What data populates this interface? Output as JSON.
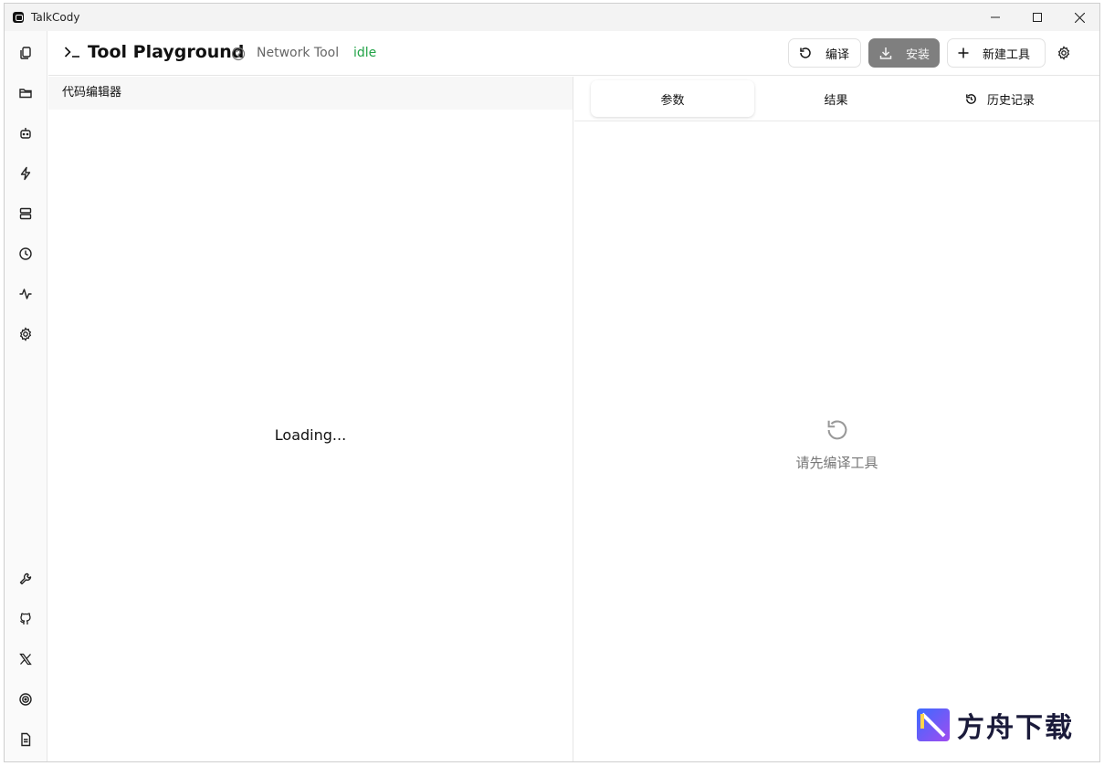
{
  "window": {
    "title": "TalkCody"
  },
  "sidebar": {
    "top_items": [
      {
        "name": "copy-icon"
      },
      {
        "name": "folder-icon"
      },
      {
        "name": "bot-icon"
      },
      {
        "name": "lightning-icon"
      },
      {
        "name": "server-icon"
      },
      {
        "name": "clock-icon"
      },
      {
        "name": "activity-icon"
      },
      {
        "name": "gear-icon"
      }
    ],
    "bottom_items": [
      {
        "name": "wrench-icon"
      },
      {
        "name": "github-icon"
      },
      {
        "name": "x-logo-icon"
      },
      {
        "name": "target-icon"
      },
      {
        "name": "document-icon"
      }
    ]
  },
  "header": {
    "title": "Tool Playground",
    "tool_name": "Network Tool",
    "status": "idle",
    "status_color": "#22a347",
    "compile_label": "编译",
    "install_label": "安装",
    "new_tool_label": "新建工具"
  },
  "editor": {
    "heading": "代码编辑器",
    "loading": "Loading..."
  },
  "results": {
    "tabs": [
      {
        "label": "参数",
        "active": true
      },
      {
        "label": "结果",
        "active": false
      },
      {
        "label": "历史记录",
        "active": false
      }
    ],
    "empty_message": "请先编译工具"
  },
  "watermark": {
    "text": "方舟下载"
  }
}
